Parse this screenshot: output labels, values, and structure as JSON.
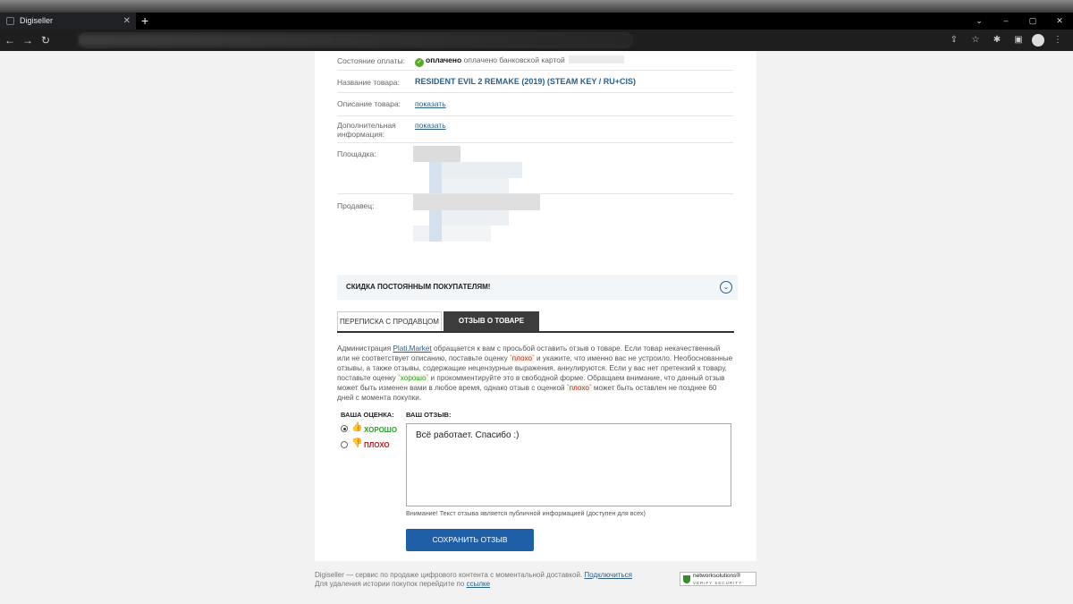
{
  "browser": {
    "tab_title": "Digiseller",
    "tab_close": "✕",
    "new_tab": "+",
    "window_buttons": [
      "⌄",
      "–",
      "▢",
      "✕"
    ],
    "nav": [
      "←",
      "→",
      "↻"
    ],
    "toolbar_icons": [
      "⇪",
      "☆",
      "✱",
      "▣",
      "⋮"
    ]
  },
  "details": {
    "payment_status_label": "Состояние оплаты:",
    "payment_status_value": "оплачено",
    "payment_status_note": "оплачено банковской картой",
    "product_name_label": "Название товара:",
    "product_name_value": "RESIDENT EVIL 2 REMAKE (2019) (STEAM KEY / RU+CIS)",
    "product_desc_label": "Описание товара:",
    "product_desc_link": "показать",
    "extra_info_label": "Дополнительная информация:",
    "extra_info_link": "показать",
    "platform_label": "Площадка:",
    "seller_label": "Продавец:"
  },
  "discount": {
    "label": "СКИДКА ПОСТОЯННЫМ ПОКУПАТЕЛЯМ!",
    "chevron": "⌄"
  },
  "tabs": {
    "chat": "ПЕРЕПИСКА С ПРОДАВЦОМ",
    "review": "ОТЗЫВ О ТОВАРЕ"
  },
  "notice": {
    "part1": "Администрация ",
    "link": "Plati.Market",
    "part2": " обращается к вам с просьбой оставить отзыв о товаре. Если товар некачественный или не соответствует описанию, поставьте оценку ",
    "bad1": "`плохо`",
    "part3": " и укажите, что именно вас не устроило. Необоснованные отзывы, а также отзывы, содержащие нецензурные выражения, аннулируются. Если у вас нет претензий к товару, поставьте оценку ",
    "good": "`хорошо`",
    "part4": " и прокомментируйте это в свободной форме. Обращаем внимание, что данный отзыв может быть изменен вами в любое время, однако отзыв с оценкой ",
    "bad2": "`плохо`",
    "part5": " может быть оставлен не позднее 60 дней с момента покупки."
  },
  "review": {
    "rating_label": "ВАША ОЦЕНКА:",
    "review_label": "ВАШ ОТЗЫВ:",
    "good_label": "ХОРОШО",
    "bad_label": "ПЛОХО",
    "selected": "good",
    "text": "Всё работает. Спасибо :)",
    "warning": "Внимание! Текст отзыва является публичной информацией (доступен для всех)",
    "save_button": "СОХРАНИТЬ ОТЗЫВ",
    "good_color": "#2aa02a",
    "bad_color": "#c02020"
  },
  "footer": {
    "line1": "Digiseller — сервис по продаже цифрового контента с моментальной доставкой. ",
    "connect_link": "Подключиться",
    "line2": "Для удаления истории покупок перейдите по ",
    "history_link": "ссылке",
    "badge_title": "networksolutions®",
    "badge_sub": "VERIFY SECURITY"
  },
  "colors": {
    "accent": "#1f5fa8",
    "link": "#2a5f8a",
    "active_tab": "#3c3c3c"
  }
}
